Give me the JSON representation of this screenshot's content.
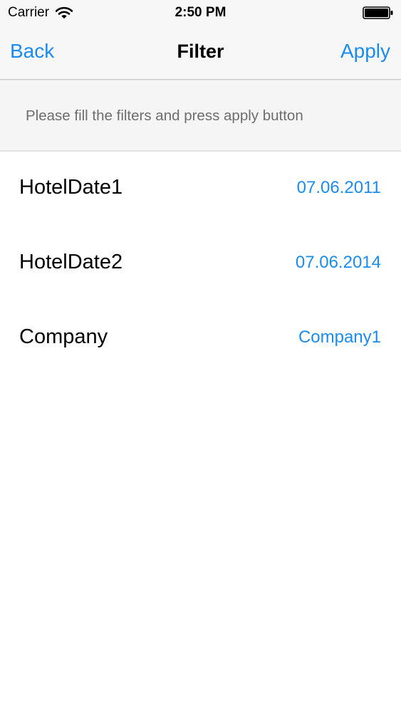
{
  "status_bar": {
    "carrier": "Carrier",
    "time": "2:50 PM",
    "icons": [
      "wifi-icon",
      "battery-icon"
    ]
  },
  "nav": {
    "back_label": "Back",
    "title": "Filter",
    "apply_label": "Apply"
  },
  "info": {
    "text": "Please fill the filters and press apply button"
  },
  "filters": [
    {
      "label": "HotelDate1",
      "value": "07.06.2011"
    },
    {
      "label": "HotelDate2",
      "value": "07.06.2014"
    },
    {
      "label": "Company",
      "value": "Company1"
    }
  ],
  "colors": {
    "accent": "#1a8cf0",
    "bar_background": "#f7f7f7",
    "banner_background": "#f5f5f5",
    "banner_text": "#6d6d6d"
  }
}
